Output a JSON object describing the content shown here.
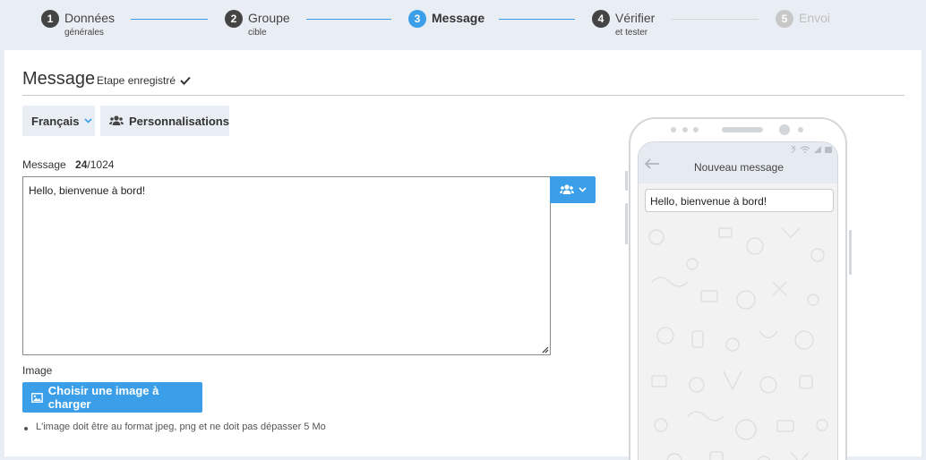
{
  "stepper": {
    "steps": [
      {
        "number": "1",
        "label": "Données",
        "sub": "générales"
      },
      {
        "number": "2",
        "label": "Groupe",
        "sub": "cible"
      },
      {
        "number": "3",
        "label": "Message",
        "sub": ""
      },
      {
        "number": "4",
        "label": "Vérifier",
        "sub": "et tester"
      },
      {
        "number": "5",
        "label": "Envoi",
        "sub": ""
      }
    ]
  },
  "header": {
    "title": "Message",
    "saved_text": "Etape enregistré"
  },
  "toolbar": {
    "language_label": "Français",
    "personalisations_label": "Personnalisations"
  },
  "message": {
    "label": "Message",
    "count": "24",
    "max": "/1024",
    "value": "Hello, bienvenue à bord!"
  },
  "image": {
    "label": "Image",
    "upload_label": "Choisir une image à charger",
    "hint": "L'image doit être au format jpeg, png et ne doit pas dépasser 5 Mo"
  },
  "preview": {
    "title": "Nouveau message",
    "bubble_text": "Hello, bienvenue à bord!"
  },
  "colors": {
    "accent": "#3a9fe8",
    "background": "#e9eef4"
  }
}
